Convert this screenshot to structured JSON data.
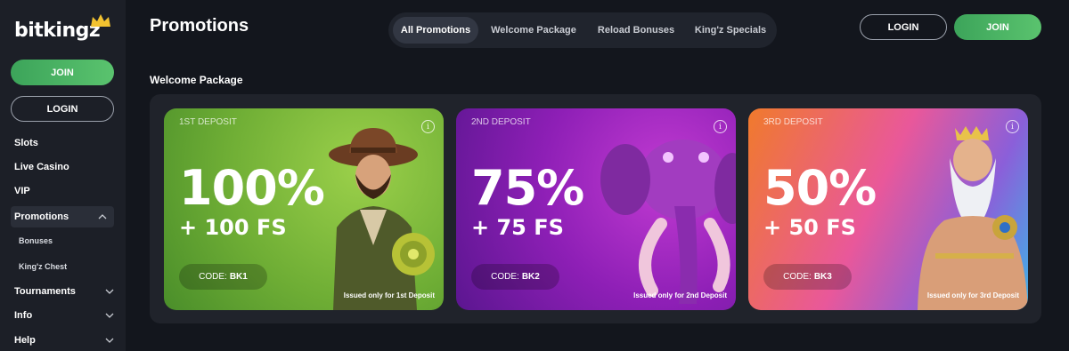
{
  "brand": {
    "logo_text": "bitkingz",
    "accent": "#4cb866"
  },
  "sidebar": {
    "join_label": "JOIN",
    "login_label": "LOGIN",
    "items": [
      {
        "label": "Slots"
      },
      {
        "label": "Live Casino"
      },
      {
        "label": "VIP"
      },
      {
        "label": "Promotions",
        "expanded": true
      },
      {
        "label": "Tournaments"
      },
      {
        "label": "Info"
      },
      {
        "label": "Help"
      }
    ],
    "sub_items": [
      {
        "label": "Bonuses"
      },
      {
        "label": "King'z Chest"
      }
    ]
  },
  "header": {
    "title": "Promotions",
    "tabs": [
      {
        "label": "All Promotions",
        "active": true
      },
      {
        "label": "Welcome Package"
      },
      {
        "label": "Reload Bonuses"
      },
      {
        "label": "King'z Specials"
      }
    ],
    "login_label": "LOGIN",
    "join_label": "JOIN"
  },
  "main": {
    "section_title": "Welcome Package",
    "cards": [
      {
        "deposit": "1ST DEPOSIT",
        "percent": "100%",
        "free_spins": "+ 100 FS",
        "code_label": "CODE:",
        "code": "BK1",
        "note": "Issued only for 1st Deposit",
        "color": "#7fbf3c"
      },
      {
        "deposit": "2ND DEPOSIT",
        "percent": "75%",
        "free_spins": "+ 75 FS",
        "code_label": "CODE:",
        "code": "BK2",
        "note": "Issued only for 2nd Deposit",
        "color": "#9b25c2"
      },
      {
        "deposit": "3RD DEPOSIT",
        "percent": "50%",
        "free_spins": "+ 50 FS",
        "code_label": "CODE:",
        "code": "BK3",
        "note": "Issued only for 3rd Deposit",
        "color": "#ee6a5c"
      }
    ]
  }
}
